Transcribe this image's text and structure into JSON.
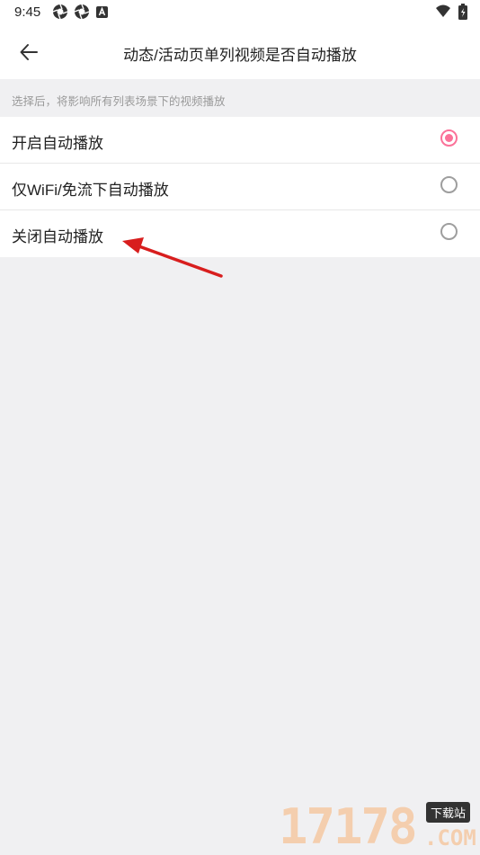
{
  "status_bar": {
    "time": "9:45",
    "left_icons": [
      "aperture-icon",
      "aperture-icon",
      "a-icon"
    ],
    "right_icons": [
      "wifi-icon",
      "battery-icon"
    ]
  },
  "app_bar": {
    "back_icon": "arrow-left-icon",
    "title": "动态/活动页单列视频是否自动播放"
  },
  "hint": "选择后，将影响所有列表场景下的视频播放",
  "options": [
    {
      "label": "开启自动播放",
      "selected": true
    },
    {
      "label": "仅WiFi/免流下自动播放",
      "selected": false
    },
    {
      "label": "关闭自动播放",
      "selected": false
    }
  ],
  "accent_color": "#fb7299",
  "watermark": {
    "number": "17178",
    "badge": "下载站",
    "suffix": ".COM"
  }
}
